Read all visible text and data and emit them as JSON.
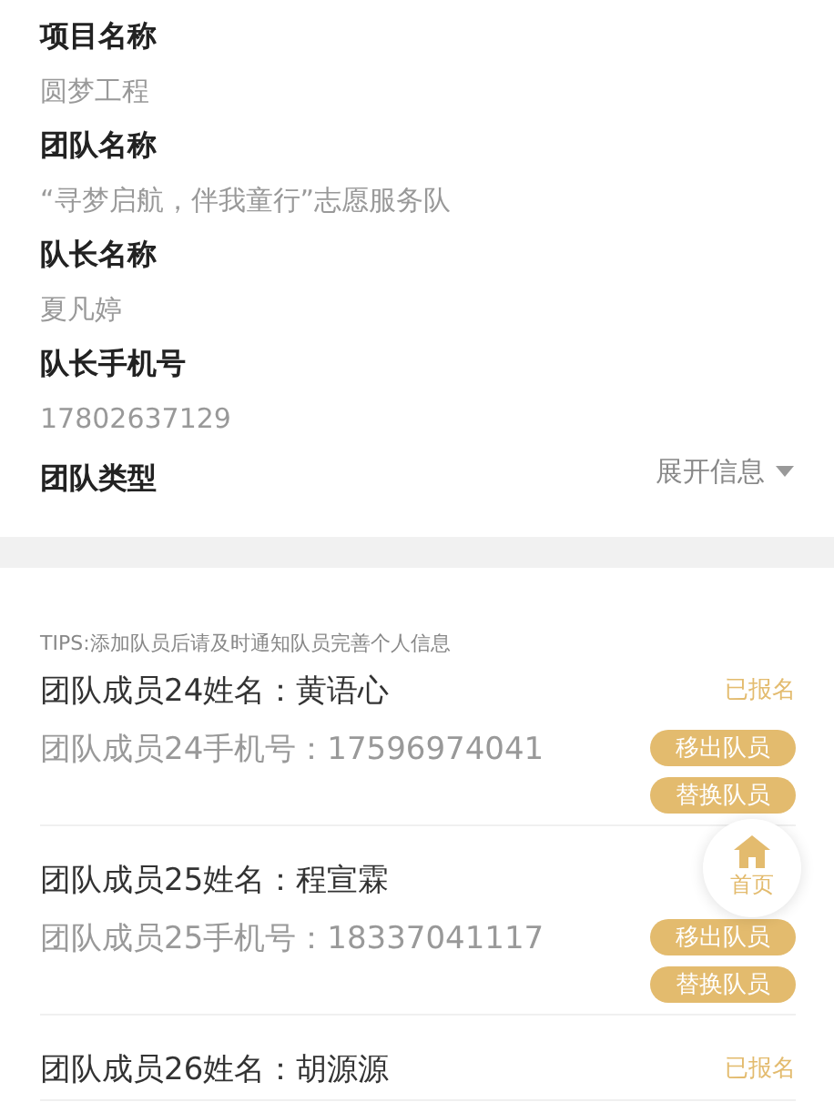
{
  "project": {
    "fields": [
      {
        "label": "项目名称",
        "value": "圆梦工程"
      },
      {
        "label": "团队名称",
        "value": "“寻梦启航，伴我童行”志愿服务队"
      },
      {
        "label": "队长名称",
        "value": "夏凡婷"
      },
      {
        "label": "队长手机号",
        "value": "17802637129"
      }
    ],
    "last_label": "团队类型",
    "expand": {
      "label": "展开信息",
      "expanded": false
    }
  },
  "tips": "TIPS:添加队员后请及时通知队员完善个人信息",
  "members": [
    {
      "name": "团队成员24姓名：黄语心",
      "phone": "团队成员24手机号：17596974041",
      "status": "已报名",
      "actions": [
        "移出队员",
        "替换队员"
      ]
    },
    {
      "name": "团队成员25姓名：程宣霖",
      "phone": "团队成员25手机号：18337041117",
      "actions": [
        "移出队员",
        "替换队员"
      ]
    },
    {
      "name": "团队成员26姓名：胡源源",
      "status": "已报名"
    }
  ],
  "home_button": {
    "label": "首页"
  }
}
